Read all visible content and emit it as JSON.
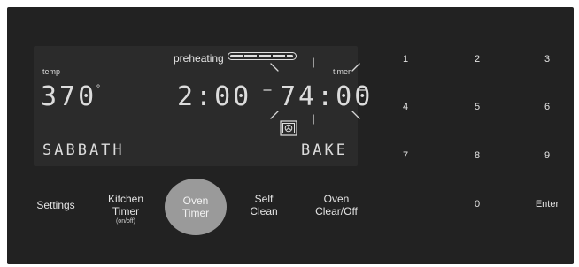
{
  "display": {
    "temp_label": "temp",
    "temperature": "370",
    "degree_symbol": "°",
    "clock": "2:00",
    "timer_label": "timer",
    "timer_value": "74:00",
    "preheating_label": "preheating",
    "preheating_progress": 1.0,
    "sabbath_text": "SABBATH",
    "mode_text": "BAKE",
    "timer_flashing": true
  },
  "controls": {
    "settings": "Settings",
    "kitchen_timer": "Kitchen\nTimer",
    "kitchen_timer_sub": "(on/off)",
    "oven_timer": "Oven\nTimer",
    "self_clean": "Self\nClean",
    "oven_clear_off": "Oven\nClear/Off"
  },
  "keypad": {
    "keys": [
      "1",
      "2",
      "3",
      "4",
      "5",
      "6",
      "7",
      "8",
      "9",
      "0",
      "Enter"
    ]
  },
  "colors": {
    "panel": "#222222",
    "lcd": "#2b2b2b",
    "text": "#dcdcdc",
    "oven_timer_active": "#9a9a9a"
  },
  "icons": {
    "oven_fan": "oven-fan-icon"
  }
}
